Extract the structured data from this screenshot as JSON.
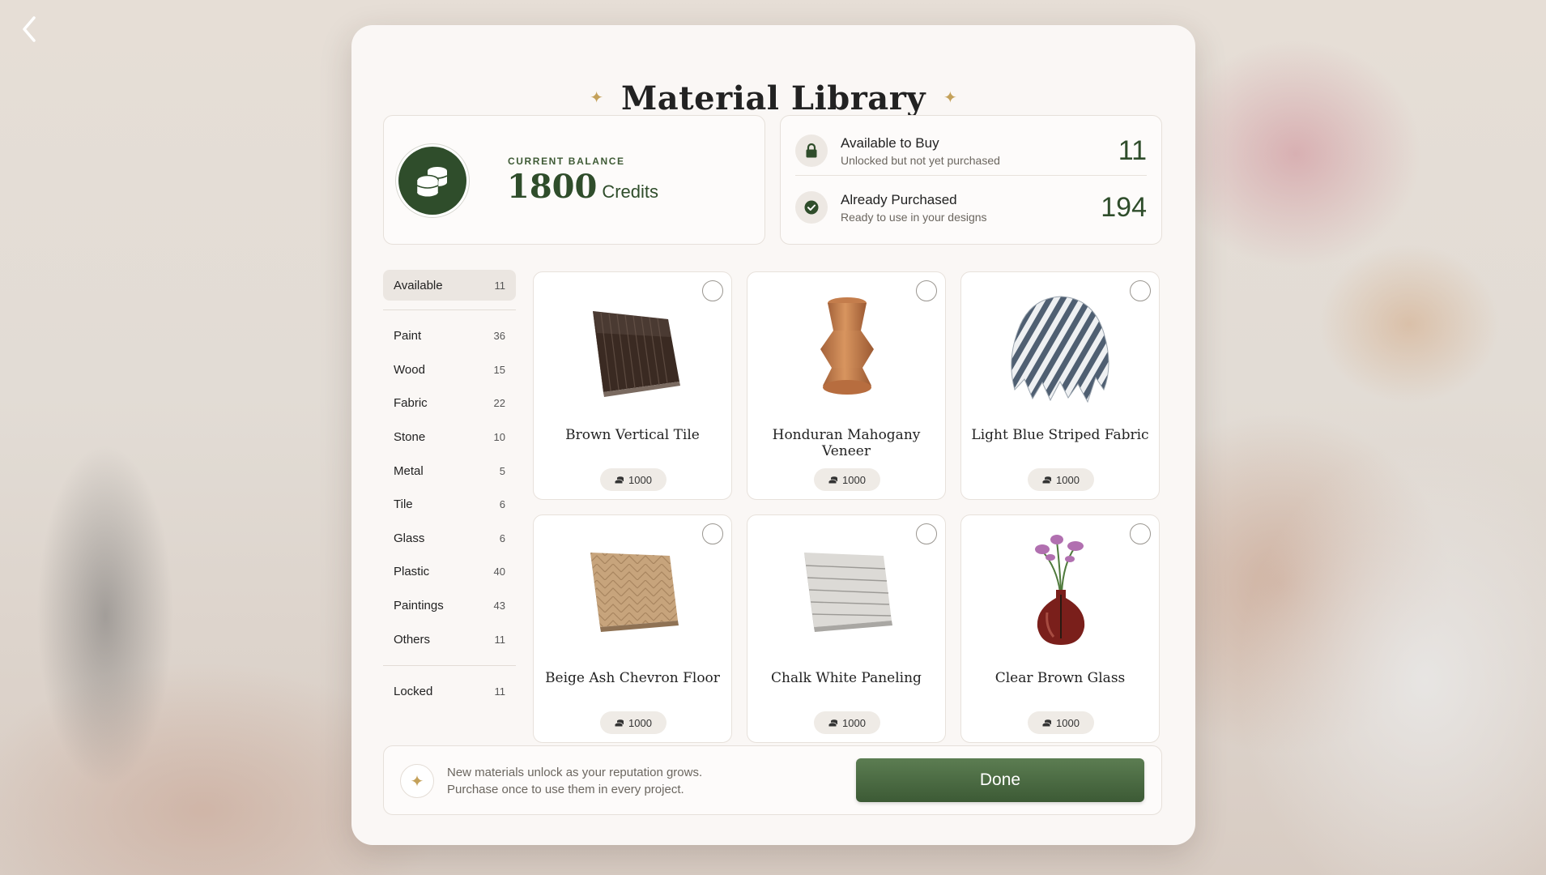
{
  "modal": {
    "title": "Material Library"
  },
  "balance": {
    "label": "CURRENT BALANCE",
    "value": "1800",
    "unit": "Credits"
  },
  "stats": [
    {
      "title": "Available to Buy",
      "subtitle": "Unlocked but not yet purchased",
      "count": "11",
      "icon": "lock-icon"
    },
    {
      "title": "Already Purchased",
      "subtitle": "Ready to use in your designs",
      "count": "194",
      "icon": "check-circle-icon"
    }
  ],
  "sidebar": {
    "top": {
      "label": "Available",
      "count": "11"
    },
    "categories": [
      {
        "label": "Paint",
        "count": "36"
      },
      {
        "label": "Wood",
        "count": "15"
      },
      {
        "label": "Fabric",
        "count": "22"
      },
      {
        "label": "Stone",
        "count": "10"
      },
      {
        "label": "Metal",
        "count": "5"
      },
      {
        "label": "Tile",
        "count": "6"
      },
      {
        "label": "Glass",
        "count": "6"
      },
      {
        "label": "Plastic",
        "count": "40"
      },
      {
        "label": "Paintings",
        "count": "43"
      },
      {
        "label": "Others",
        "count": "11"
      }
    ],
    "bottom": {
      "label": "Locked",
      "count": "11"
    }
  },
  "materials": [
    {
      "name": "Brown Vertical Tile",
      "price": "1000"
    },
    {
      "name": "Honduran Mahogany Veneer",
      "price": "1000"
    },
    {
      "name": "Light Blue Striped Fabric",
      "price": "1000"
    },
    {
      "name": "Beige Ash Chevron Floor",
      "price": "1000"
    },
    {
      "name": "Chalk White Paneling",
      "price": "1000"
    },
    {
      "name": "Clear Brown Glass",
      "price": "1000"
    }
  ],
  "footer": {
    "line1": "New materials unlock as your reputation grows.",
    "line2": "Purchase once to use them in every project.",
    "done_label": "Done"
  },
  "colors": {
    "accent_green": "#2f4d2b",
    "gold": "#c4a15a",
    "panel": "#faf7f5"
  }
}
